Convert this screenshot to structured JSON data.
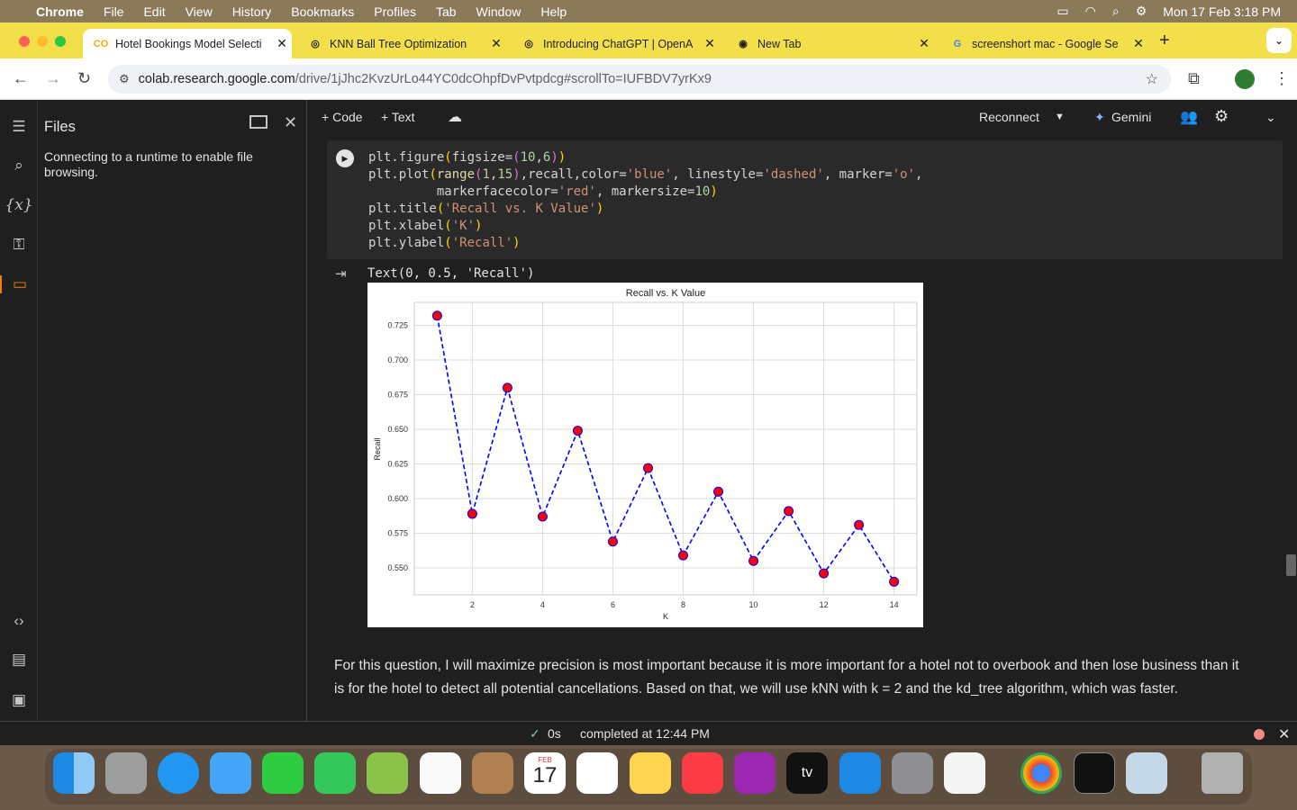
{
  "menubar": {
    "app": "Chrome",
    "items": [
      "File",
      "Edit",
      "View",
      "History",
      "Bookmarks",
      "Profiles",
      "Tab",
      "Window",
      "Help"
    ],
    "clock": "Mon 17 Feb  3:18 PM"
  },
  "tabs": [
    {
      "label": "Hotel Bookings Model Selecti",
      "fav": "CO",
      "active": true
    },
    {
      "label": "KNN Ball Tree Optimization",
      "fav": "◎",
      "active": false
    },
    {
      "label": "Introducing ChatGPT | OpenA",
      "fav": "◎",
      "active": false
    },
    {
      "label": "New Tab",
      "fav": "◉",
      "active": false
    },
    {
      "label": "screenshort mac - Google Se",
      "fav": "G",
      "active": false
    }
  ],
  "omnibox": {
    "host": "colab.research.google.com",
    "path": "/drive/1jJhc2KvzUrLo44YC0dcOhpfDvPvtpdcg#scrollTo=IUFBDV7yrKx9"
  },
  "files_panel": {
    "title": "Files",
    "message": "Connecting to a runtime to enable file browsing."
  },
  "colab_bar": {
    "code_label": "Code",
    "text_label": "Text",
    "reconnect": "Reconnect",
    "gemini": "Gemini"
  },
  "output_text": "Text(0, 0.5, 'Recall')",
  "chart_data": {
    "type": "line",
    "title": "Recall vs. K Value",
    "xlabel": "K",
    "ylabel": "Recall",
    "x": [
      1,
      2,
      3,
      4,
      5,
      6,
      7,
      8,
      9,
      10,
      11,
      12,
      13,
      14
    ],
    "values": [
      0.732,
      0.589,
      0.68,
      0.587,
      0.649,
      0.569,
      0.622,
      0.559,
      0.605,
      0.555,
      0.591,
      0.546,
      0.581,
      0.54
    ],
    "xticks": [
      "2",
      "4",
      "6",
      "8",
      "10",
      "12",
      "14"
    ],
    "yticks": [
      "0.550",
      "0.575",
      "0.600",
      "0.625",
      "0.650",
      "0.675",
      "0.700",
      "0.725"
    ],
    "xlim": [
      0.35,
      14.65
    ],
    "ylim": [
      0.5305,
      0.7416
    ],
    "line_color": "#0000ff",
    "line_style": "dashed",
    "marker_color": "#ff0000",
    "grid": true
  },
  "paragraph": "For this question, I will maximize precision is most important because it is more important for a hotel not to overbook and then lose business than it is for the hotel to detect all potential cancellations. Based on that, we will use kNN with k = 2 and the kd_tree algorithm, which was faster.",
  "status": {
    "time": "0s",
    "completed": "completed at 12:44 PM"
  },
  "dock": {
    "calendar_month": "FEB",
    "calendar_day": "17",
    "tv": "tv"
  }
}
